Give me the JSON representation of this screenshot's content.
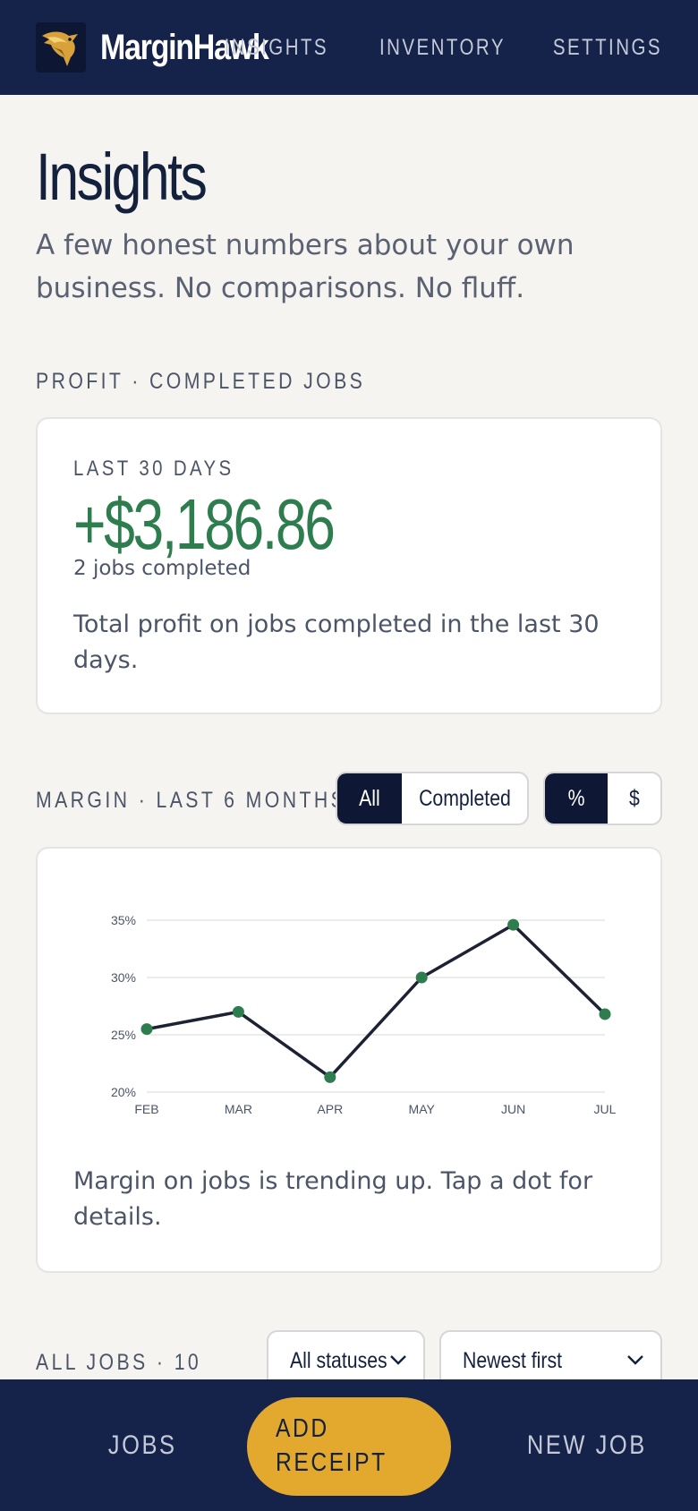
{
  "header": {
    "brand": "MarginHawk",
    "logo_icon": "hawk-logo-icon",
    "nav": [
      "INSIGHTS",
      "INVENTORY",
      "SETTINGS"
    ]
  },
  "page": {
    "title": "Insights",
    "subtitle": "A few honest numbers about your own business. No comparisons. No fluff."
  },
  "profit": {
    "section_label": "PROFIT · COMPLETED JOBS",
    "period": "LAST 30 DAYS",
    "amount": "+$3,186.86",
    "jobs": "2 jobs completed",
    "description": "Total profit on jobs completed in the last 30 days.",
    "color": "#2e7d4f"
  },
  "margin": {
    "section_label": "MARGIN · LAST 6 MONTHS",
    "filter": {
      "options": [
        "All",
        "Completed"
      ],
      "selected": "All"
    },
    "unit": {
      "options": [
        "%",
        "$"
      ],
      "selected": "%"
    },
    "caption": "Margin on jobs is trending up. Tap a dot for details."
  },
  "chart_data": {
    "type": "line",
    "categories": [
      "FEB",
      "MAR",
      "APR",
      "MAY",
      "JUN",
      "JUL"
    ],
    "values": [
      25.5,
      27.0,
      21.3,
      30.0,
      34.6,
      26.8
    ],
    "yticks": [
      "20%",
      "25%",
      "30%",
      "35%"
    ],
    "ylim": [
      20,
      35
    ],
    "grid": true,
    "line_color": "#1c2233",
    "point_color": "#2e7d4f"
  },
  "jobs": {
    "section_label": "ALL JOBS · 10",
    "status_select": "All statuses",
    "sort_select": "Newest first"
  },
  "bottom_nav": {
    "jobs": "JOBS",
    "add_receipt": [
      "ADD",
      "RECEIPT"
    ],
    "new_job": "NEW JOB"
  }
}
